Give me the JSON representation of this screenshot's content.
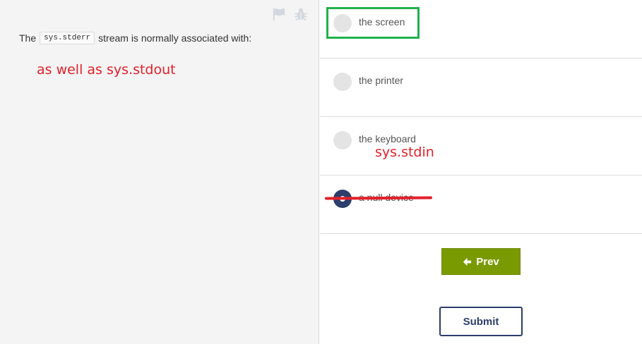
{
  "question": {
    "prefix": "The",
    "code": "sys.stderr",
    "suffix": "stream is normally associated with:"
  },
  "toolbar": {
    "icons": [
      "flag-icon",
      "bug-icon"
    ]
  },
  "annotations": {
    "left_note": "as well as sys.stdout",
    "right_note": "sys.stdin",
    "highlight_color": "#22b14c",
    "mark_color": "#e3202a"
  },
  "options": [
    {
      "label": "the screen",
      "selected": false
    },
    {
      "label": "the printer",
      "selected": false
    },
    {
      "label": "the keyboard",
      "selected": false
    },
    {
      "label": "a null device",
      "selected": true
    }
  ],
  "buttons": {
    "prev_label": "Prev",
    "submit_label": "Submit"
  },
  "colors": {
    "prev_bg": "#7a9a01",
    "submit_border": "#2c3e6b",
    "radio_selected": "#2c3e6b"
  }
}
